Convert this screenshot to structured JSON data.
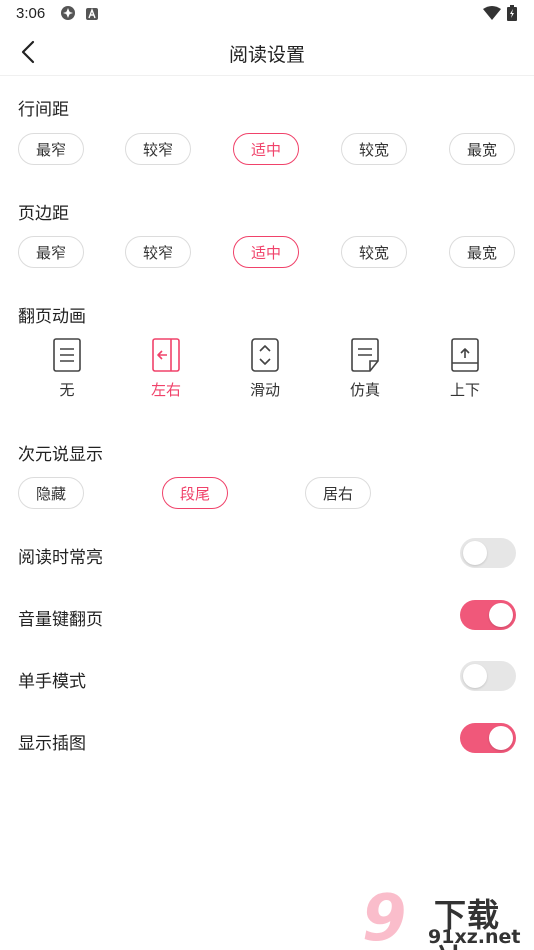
{
  "status": {
    "time": "3:06"
  },
  "header": {
    "title": "阅读设置"
  },
  "line_spacing": {
    "title": "行间距",
    "options": [
      "最窄",
      "较窄",
      "适中",
      "较宽",
      "最宽"
    ],
    "selected": "适中"
  },
  "page_margin": {
    "title": "页边距",
    "options": [
      "最窄",
      "较窄",
      "适中",
      "较宽",
      "最宽"
    ],
    "selected": "适中"
  },
  "page_animation": {
    "title": "翻页动画",
    "options": [
      {
        "label": "无",
        "icon": "page-lines-icon"
      },
      {
        "label": "左右",
        "icon": "page-left-arrow-icon"
      },
      {
        "label": "滑动",
        "icon": "page-up-down-chevron-icon"
      },
      {
        "label": "仿真",
        "icon": "page-curl-icon"
      },
      {
        "label": "上下",
        "icon": "page-up-arrow-icon"
      }
    ],
    "selected": "左右"
  },
  "ciyuan_display": {
    "title": "次元说显示",
    "options": [
      "隐藏",
      "段尾",
      "居右"
    ],
    "selected": "段尾"
  },
  "toggles": [
    {
      "label": "阅读时常亮",
      "on": false
    },
    {
      "label": "音量键翻页",
      "on": true
    },
    {
      "label": "单手模式",
      "on": false
    },
    {
      "label": "显示插图",
      "on": true
    }
  ],
  "watermark": {
    "brand": "下载站",
    "site": "91xz.net",
    "number": "9"
  },
  "colors": {
    "accent": "#f0426a",
    "toggle_on": "#f0587a",
    "toggle_off": "#e6e6e6",
    "pill_border": "#dcdcdc"
  }
}
